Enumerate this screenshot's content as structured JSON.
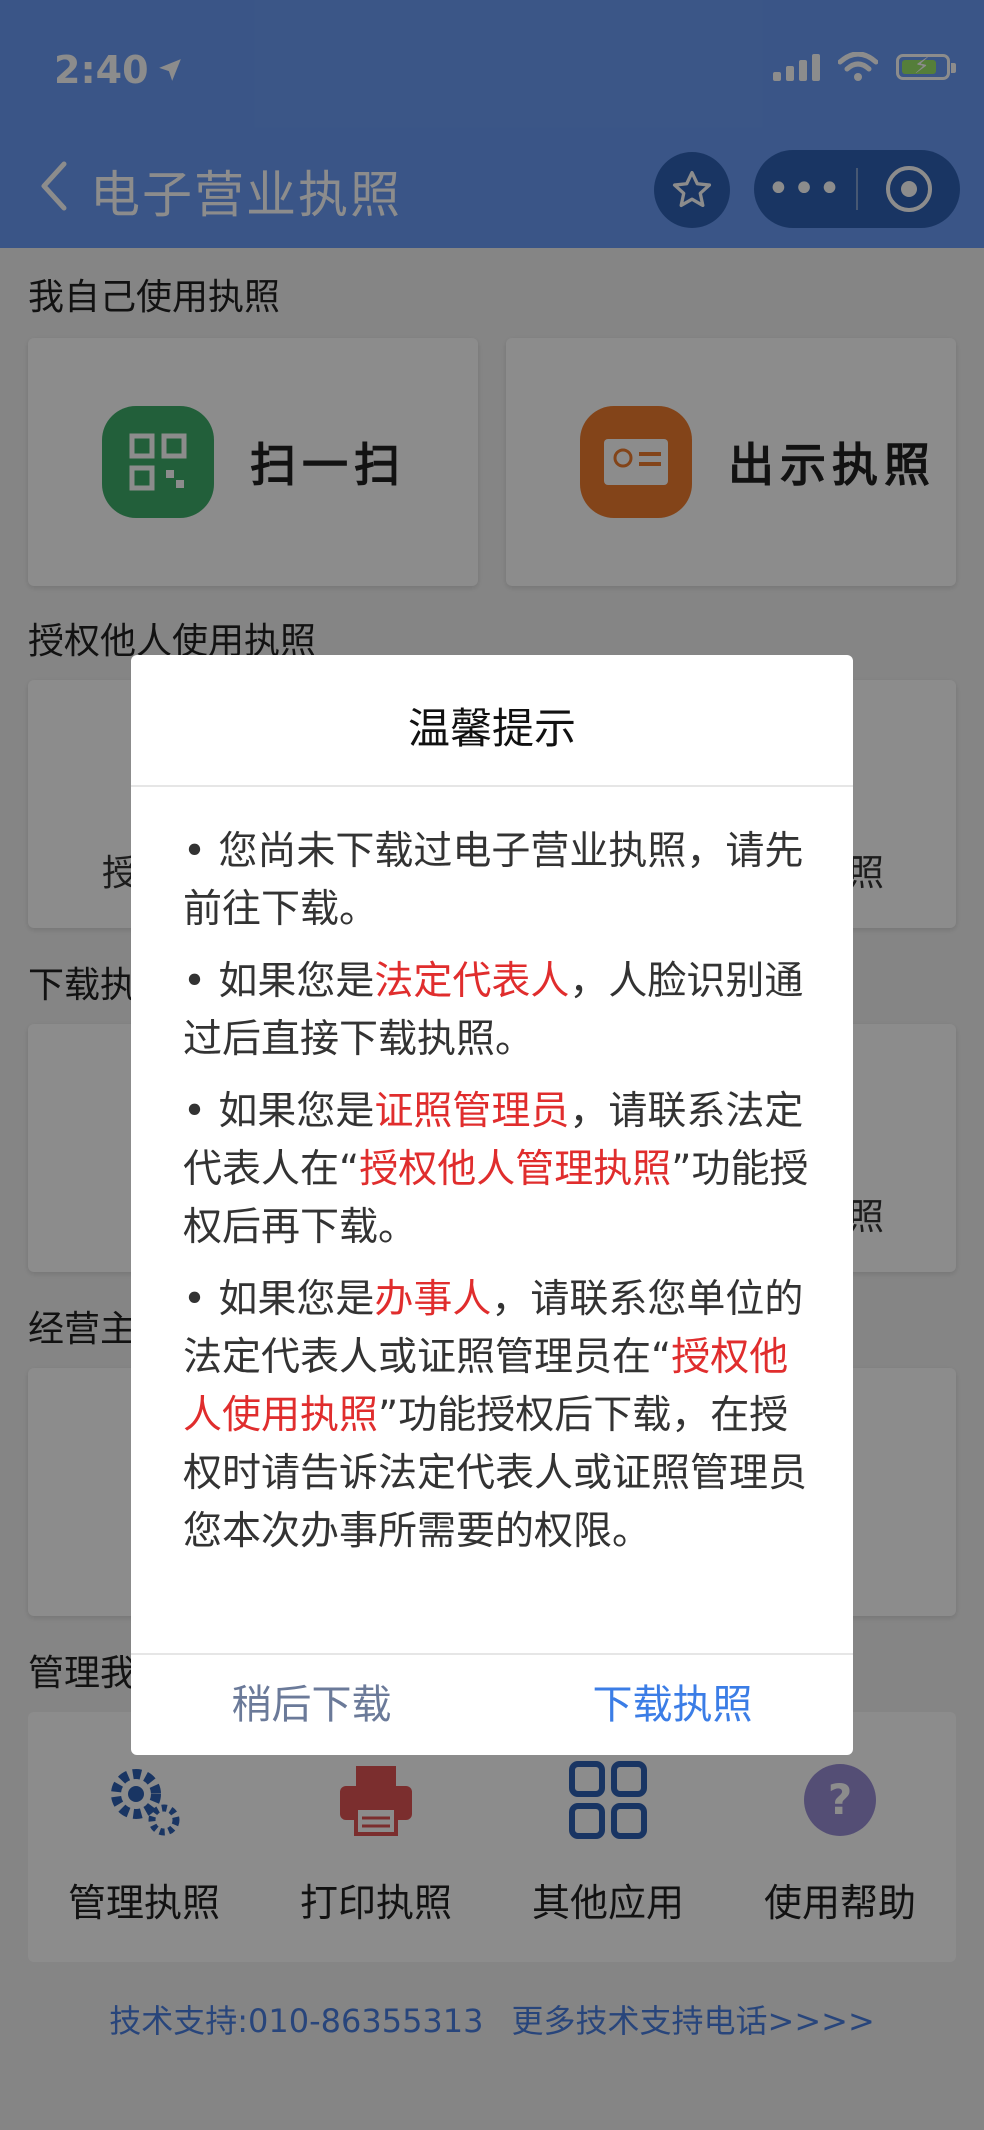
{
  "status": {
    "time": "2:40"
  },
  "nav": {
    "title": "电子营业执照"
  },
  "sections": {
    "self_use": "我自己使用执照",
    "authorize": "授权他人使用执照",
    "download": "下载执",
    "entity": "经营主",
    "manage": "管理我"
  },
  "cards": {
    "scan": "扫一扫",
    "show": "出示执照",
    "ghost_left_1": "授",
    "ghost_right_1": "照",
    "ghost_right_2": "照"
  },
  "bottom": [
    {
      "label": "管理执照",
      "icon": "gear-icon"
    },
    {
      "label": "打印执照",
      "icon": "printer-icon"
    },
    {
      "label": "其他应用",
      "icon": "grid-icon"
    },
    {
      "label": "使用帮助",
      "icon": "help-icon"
    }
  ],
  "support": {
    "phone": "技术支持:010-86355313",
    "more": "更多技术支持电话>>>>"
  },
  "dialog": {
    "title": "温馨提示",
    "p1": "• 您尚未下载过电子营业执照，请先前往下载。",
    "p2_a": "• 如果您是",
    "p2_red": "法定代表人",
    "p2_b": "，人脸识别通过后直接下载执照。",
    "p3_a": "• 如果您是",
    "p3_red": "证照管理员",
    "p3_b": "，请联系法定代表人在“",
    "p3_red2": "授权他人管理执照",
    "p3_c": "”功能授权后再下载。",
    "p4_a": "• 如果您是",
    "p4_red": "办事人",
    "p4_b": "，请联系您单位的法定代表人或证照管理员在“",
    "p4_red2": "授权他人使用执照",
    "p4_c": "”功能授权后下载，在授权时请告诉法定代表人或证照管理员您本次办事所需要的权限。",
    "btn_later": "稍后下载",
    "btn_download": "下载执照"
  },
  "colors": {
    "header": "#6b9cf6",
    "accent": "#3b7de6",
    "highlight": "#e02d2d"
  }
}
